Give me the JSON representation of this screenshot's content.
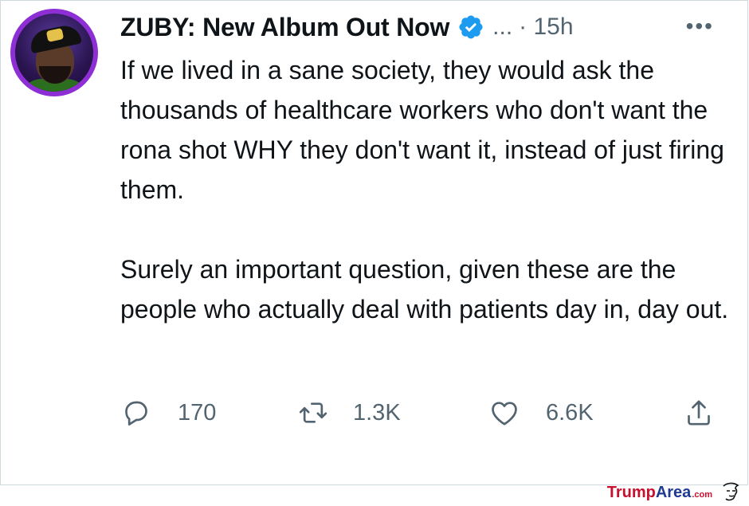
{
  "tweet": {
    "author_name": "ZUBY: New Album Out Now",
    "handle": "...",
    "time": "· 15h",
    "more": "•••",
    "paragraphs": [
      "If we lived in a sane society, they would ask the thousands of healthcare workers who don't want the rona shot WHY they don't want it, instead of just firing them.",
      "Surely an important question, given these are the people who actually deal with patients day in, day out."
    ],
    "stats": {
      "replies": "170",
      "retweets": "1.3K",
      "likes": "6.6K"
    }
  },
  "watermark": {
    "part1": "Trump",
    "part2": "Area",
    "part3": ".com"
  },
  "colors": {
    "verified": "#1d9bf0",
    "secondary_text": "#536471",
    "avatar_ring": "#8e2fd6"
  },
  "icons": [
    "verified-badge-icon",
    "more-icon",
    "reply-icon",
    "retweet-icon",
    "like-icon",
    "share-icon"
  ]
}
